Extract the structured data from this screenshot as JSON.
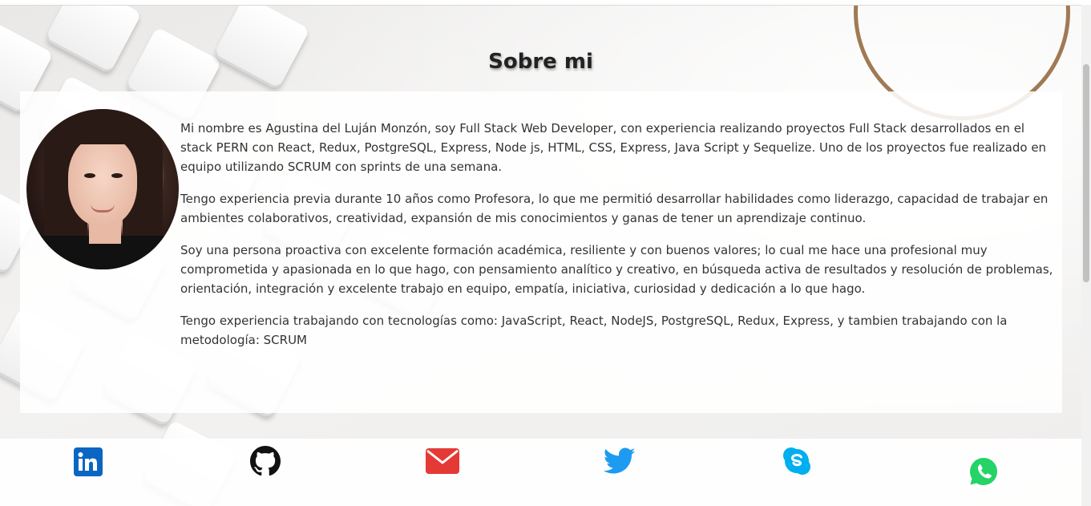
{
  "section": {
    "title": "Sobre mi"
  },
  "bio": {
    "paragraphs": [
      "Mi nombre es Agustina del Luján Monzón, soy Full Stack Web Developer, con experiencia realizando proyectos Full Stack desarrollados en el stack PERN con React, Redux, PostgreSQL, Express, Node js, HTML, CSS, Express, Java Script y Sequelize. Uno de los proyectos fue realizado en equipo utilizando SCRUM con sprints de una semana.",
      "Tengo experiencia previa durante 10 años como Profesora, lo que me permitió desarrollar habilidades como liderazgo, capacidad de trabajar en ambientes colaborativos, creatividad, expansión de mis conocimientos y ganas de tener un aprendizaje continuo.",
      "Soy una persona proactiva con excelente formación académica, resiliente y con buenos valores; lo cual me hace una profesional muy comprometida y apasionada en lo que hago, con pensamiento analítico y creativo, en búsqueda activa de resultados y resolución de problemas, orientación, integración y excelente trabajo en equipo, empatía, iniciativa, curiosidad y dedicación a lo que hago.",
      "Tengo experiencia trabajando con tecnologías como: JavaScript, React, NodeJS, PostgreSQL, Redux, Express, y tambien trabajando con la metodología: SCRUM"
    ]
  },
  "social": [
    {
      "icon": "linkedin-icon",
      "color": "#0a66c2"
    },
    {
      "icon": "github-icon",
      "color": "#111111"
    },
    {
      "icon": "email-icon",
      "color": "#e53935"
    },
    {
      "icon": "twitter-icon",
      "color": "#1d9bf0"
    },
    {
      "icon": "skype-icon",
      "color": "#00aff0"
    },
    {
      "icon": "whatsapp-icon",
      "color": "#25d366"
    }
  ]
}
